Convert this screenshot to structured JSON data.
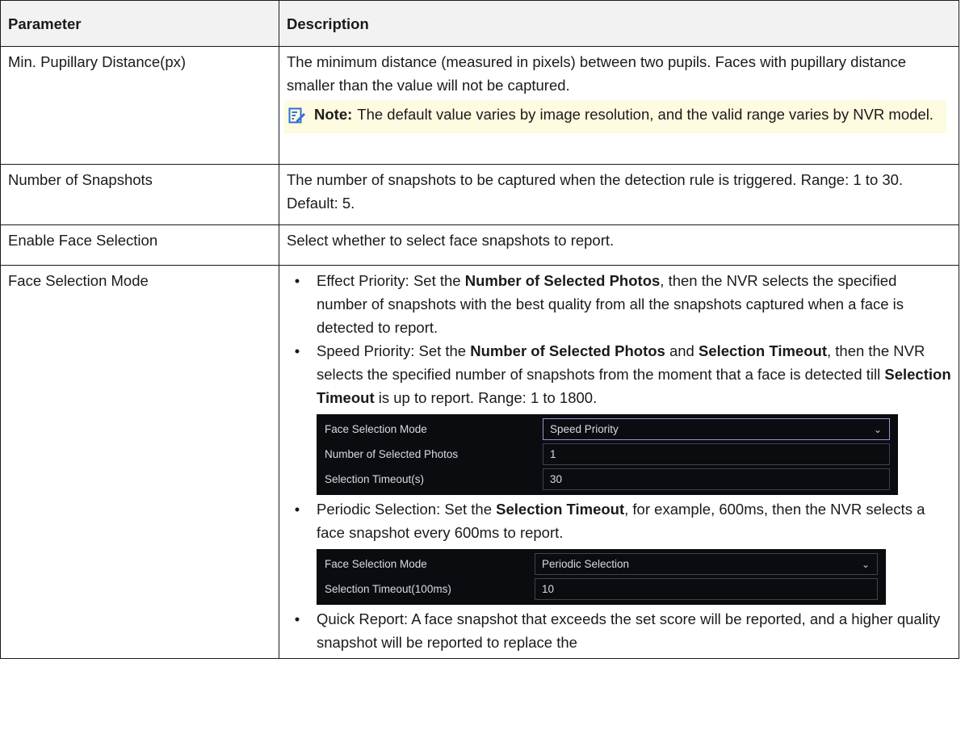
{
  "table": {
    "headers": {
      "parameter": "Parameter",
      "description": "Description"
    },
    "rows": {
      "pupil": {
        "parameter": "Min. Pupillary Distance(px)",
        "description": "The minimum distance (measured in pixels) between two pupils. Faces with pupillary distance smaller than the value will not be captured.",
        "note_label": "Note:",
        "note_text": "The default value varies by image resolution, and the valid range varies by NVR model."
      },
      "snapshots": {
        "parameter": "Number of Snapshots",
        "description": "The number of snapshots to be captured when the detection rule is triggered. Range: 1 to 30. Default: 5."
      },
      "enable": {
        "parameter": "Enable Face Selection",
        "description": "Select whether to select face snapshots to report."
      },
      "mode": {
        "parameter": "Face Selection Mode",
        "bullet": "•",
        "effect": {
          "t1": "Effect Priority: Set the ",
          "b1": "Number of Selected Photos",
          "t2": ", then the NVR selects the specified number of snapshots with the best quality from all the snapshots captured when a face is detected to report."
        },
        "speed": {
          "t1": "Speed Priority: Set the ",
          "b1": "Number of Selected Photos",
          "t2": " and ",
          "b2": "Selection Timeout",
          "t3": ", then the NVR selects the specified number of snapshots from the moment that a face is detected till ",
          "b3": "Selection Timeout",
          "t4": " is up to report. Range: 1 to 1800."
        },
        "speed_panel": {
          "mode_label": "Face Selection Mode",
          "mode_value": "Speed Priority",
          "photos_label": "Number of Selected Photos",
          "photos_value": "1",
          "timeout_label": "Selection Timeout(s)",
          "timeout_value": "30"
        },
        "periodic": {
          "t1": "Periodic Selection: Set the ",
          "b1": "Selection Timeout",
          "t2": ", for example, 600ms, then the NVR selects a face snapshot every 600ms to report."
        },
        "periodic_panel": {
          "mode_label": "Face Selection Mode",
          "mode_value": "Periodic Selection",
          "timeout_label": "Selection Timeout(100ms)",
          "timeout_value": "10"
        },
        "quick": {
          "text": "Quick Report: A face snapshot that exceeds the set score will be reported, and a higher quality snapshot will be reported to replace the"
        }
      }
    }
  },
  "colors": {
    "note_background": "#fdfbe0",
    "note_icon": "#2f6fd8",
    "panel_background": "#0b0c10",
    "header_background": "#f2f2f2"
  },
  "icons": {
    "note": "note-pen-icon",
    "dropdown": "chevron-down-icon"
  }
}
